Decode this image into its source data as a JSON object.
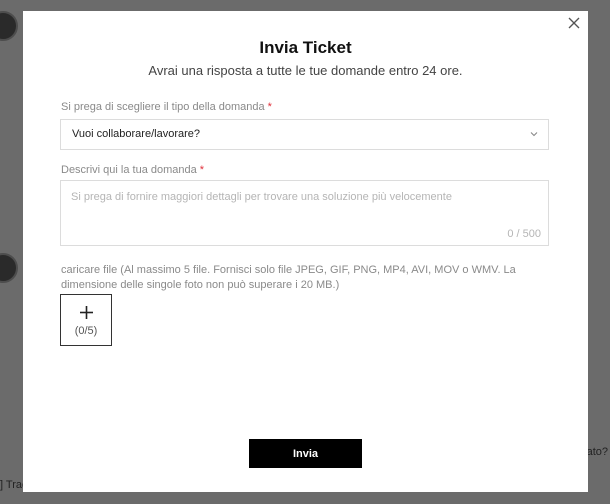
{
  "modal": {
    "title": "Invia Ticket",
    "subtitle": "Avrai una risposta a tutte le tue domande entro 24 ore.",
    "close_icon": "close-icon"
  },
  "question_type": {
    "label": "Si prega di scegliere il tipo della domanda",
    "required_mark": "*",
    "selected": "Vuoi collaborare/lavorare?",
    "icon": "chevron-down-icon"
  },
  "description": {
    "label": "Descrivi qui la tua domanda",
    "required_mark": "*",
    "value": "",
    "placeholder": "Si prega di fornire maggiori dettagli per trovare una soluzione più velocemente",
    "counter": "0 / 500"
  },
  "upload": {
    "info": "caricare file (Al massimo 5 file. Fornisci solo file JPEG, GIF, PNG, MP4, AVI, MOV o WMV. La dimensione delle singole foto non può superare i 20 MB.)",
    "count": "(0/5)",
    "icon": "plus-icon"
  },
  "submit_label": "Invia",
  "background": {
    "right_snippet": "ato?",
    "bottom_snippet": "] Trac"
  },
  "colors": {
    "overlay": "#6b6b6b",
    "required": "#e0303a",
    "submit_bg": "#000000"
  }
}
